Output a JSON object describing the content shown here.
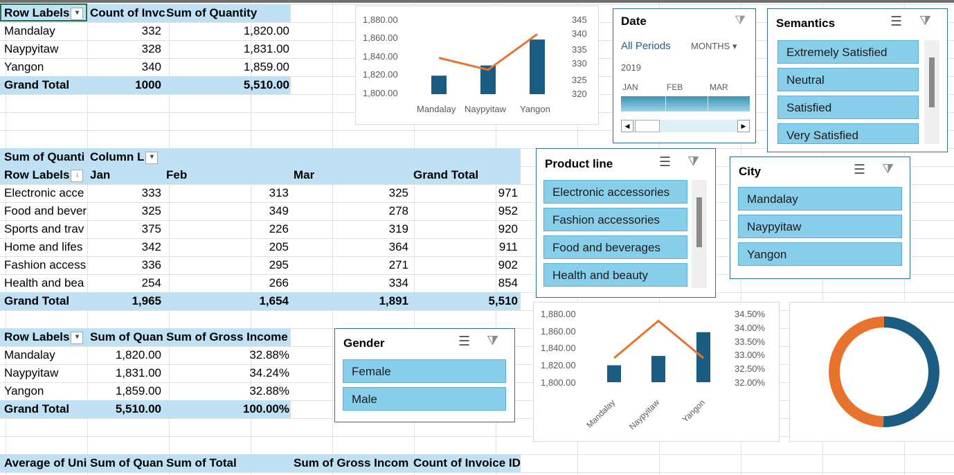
{
  "colors": {
    "bar": "#1b5c82",
    "line": "#e8732f",
    "header": "#bfe1f3",
    "slicer_item": "#87ceeb",
    "slicer_border": "#2e6f8e"
  },
  "pivot1": {
    "headers": [
      "Row Labels",
      "Count of Invc",
      "Sum of Quantity"
    ],
    "rows": [
      {
        "label": "Mandalay",
        "count": "332",
        "qty": "1,820.00"
      },
      {
        "label": "Naypyitaw",
        "count": "328",
        "qty": "1,831.00"
      },
      {
        "label": "Yangon",
        "count": "340",
        "qty": "1,859.00"
      }
    ],
    "total": {
      "label": "Grand Total",
      "count": "1000",
      "qty": "5,510.00"
    }
  },
  "pivot2": {
    "title": "Sum of Quanti",
    "column_labels": "Column L",
    "row_labels": "Row Labels",
    "months": [
      "Jan",
      "Feb",
      "Mar",
      "Grand Total"
    ],
    "rows": [
      {
        "label": "Electronic acce",
        "jan": "333",
        "feb": "313",
        "mar": "325",
        "total": "971"
      },
      {
        "label": "Food and bever",
        "jan": "325",
        "feb": "349",
        "mar": "278",
        "total": "952"
      },
      {
        "label": "Sports and trav",
        "jan": "375",
        "feb": "226",
        "mar": "319",
        "total": "920"
      },
      {
        "label": "Home and lifes",
        "jan": "342",
        "feb": "205",
        "mar": "364",
        "total": "911"
      },
      {
        "label": "Fashion access",
        "jan": "336",
        "feb": "295",
        "mar": "271",
        "total": "902"
      },
      {
        "label": "Health and bea",
        "jan": "254",
        "feb": "266",
        "mar": "334",
        "total": "854"
      }
    ],
    "total": {
      "label": "Grand Total",
      "jan": "1,965",
      "feb": "1,654",
      "mar": "1,891",
      "total": "5,510"
    }
  },
  "pivot3": {
    "headers": [
      "Row Labels",
      "Sum of Quan",
      "Sum of Gross Income"
    ],
    "rows": [
      {
        "label": "Mandalay",
        "qty": "1,820.00",
        "gross": "32.88%"
      },
      {
        "label": "Naypyitaw",
        "qty": "1,831.00",
        "gross": "34.24%"
      },
      {
        "label": "Yangon",
        "qty": "1,859.00",
        "gross": "32.88%"
      }
    ],
    "total": {
      "label": "Grand Total",
      "qty": "5,510.00",
      "gross": "100.00%"
    }
  },
  "pivot4": {
    "headers": [
      "Average of Uni",
      "Sum of Quan",
      "Sum of Total",
      "Sum of Gross Incom",
      "Count of Invoice ID"
    ]
  },
  "chart1": {
    "left_ticks": [
      "1,880.00",
      "1,860.00",
      "1,840.00",
      "1,820.00",
      "1,800.00"
    ],
    "right_ticks": [
      "345",
      "340",
      "335",
      "330",
      "325",
      "320"
    ],
    "categories": [
      "Mandalay",
      "Naypyitaw",
      "Yangon"
    ]
  },
  "chart2": {
    "left_ticks": [
      "1,880.00",
      "1,860.00",
      "1,840.00",
      "1,820.00",
      "1,800.00"
    ],
    "right_ticks": [
      "34.50%",
      "34.00%",
      "33.50%",
      "33.00%",
      "32.50%",
      "32.00%"
    ],
    "categories": [
      "Mandalay",
      "Naypyitaw",
      "Yangon"
    ]
  },
  "chart_data": [
    {
      "type": "bar",
      "categories": [
        "Mandalay",
        "Naypyitaw",
        "Yangon"
      ],
      "series": [
        {
          "name": "Sum of Quantity",
          "values": [
            1820,
            1831,
            1859
          ]
        },
        {
          "name": "Count of Invoice ID",
          "values": [
            332,
            328,
            340
          ]
        }
      ],
      "ylim": [
        1800,
        1880
      ],
      "y2lim": [
        320,
        345
      ]
    },
    {
      "type": "bar",
      "categories": [
        "Mandalay",
        "Naypyitaw",
        "Yangon"
      ],
      "series": [
        {
          "name": "Sum of Quantity",
          "values": [
            1820,
            1831,
            1859
          ]
        },
        {
          "name": "Sum of Gross Income",
          "values": [
            32.88,
            34.24,
            32.88
          ]
        }
      ],
      "ylim": [
        1800,
        1880
      ],
      "y2lim": [
        32.0,
        34.5
      ]
    },
    {
      "type": "pie",
      "categories": [
        "Female",
        "Male"
      ],
      "values": [
        49.8,
        50.2
      ]
    }
  ],
  "date_slicer": {
    "title": "Date",
    "all_periods": "All Periods",
    "unit": "MONTHS",
    "year": "2019",
    "months": [
      "JAN",
      "FEB",
      "MAR"
    ]
  },
  "semantics_slicer": {
    "title": "Semantics",
    "items": [
      "Extremely Satisfied",
      "Neutral",
      "Satisfied",
      "Very Satisfied"
    ]
  },
  "product_slicer": {
    "title": "Product line",
    "items": [
      "Electronic accessories",
      "Fashion accessories",
      "Food and beverages",
      "Health and beauty"
    ]
  },
  "city_slicer": {
    "title": "City",
    "items": [
      "Mandalay",
      "Naypyitaw",
      "Yangon"
    ]
  },
  "gender_slicer": {
    "title": "Gender",
    "items": [
      "Female",
      "Male"
    ]
  },
  "icons": {
    "multiselect": "multiselect-icon",
    "clear_filter": "clear-filter-icon",
    "sort": "sort-desc-icon",
    "dropdown": "dropdown-arrow-icon"
  }
}
